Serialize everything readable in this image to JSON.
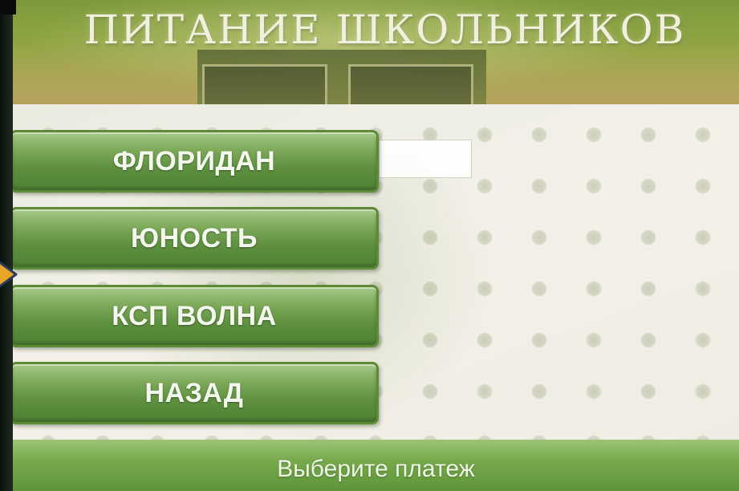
{
  "header": {
    "title": "ПИТАНИЕ ШКОЛЬНИКОВ"
  },
  "menu": {
    "buttons": [
      {
        "label": "ФЛОРИДАН"
      },
      {
        "label": "ЮНОСТЬ"
      },
      {
        "label": "КСП ВОЛНА"
      },
      {
        "label": "НАЗАД"
      }
    ]
  },
  "footer": {
    "status_text": "Выберите платеж"
  },
  "colors": {
    "button_green": "#5e9040",
    "header_green": "#8ea443",
    "footer_green": "#78a94d",
    "arrow_yellow": "#e8a52a"
  },
  "icons": {
    "side_indicator": "chevron-right-icon"
  }
}
